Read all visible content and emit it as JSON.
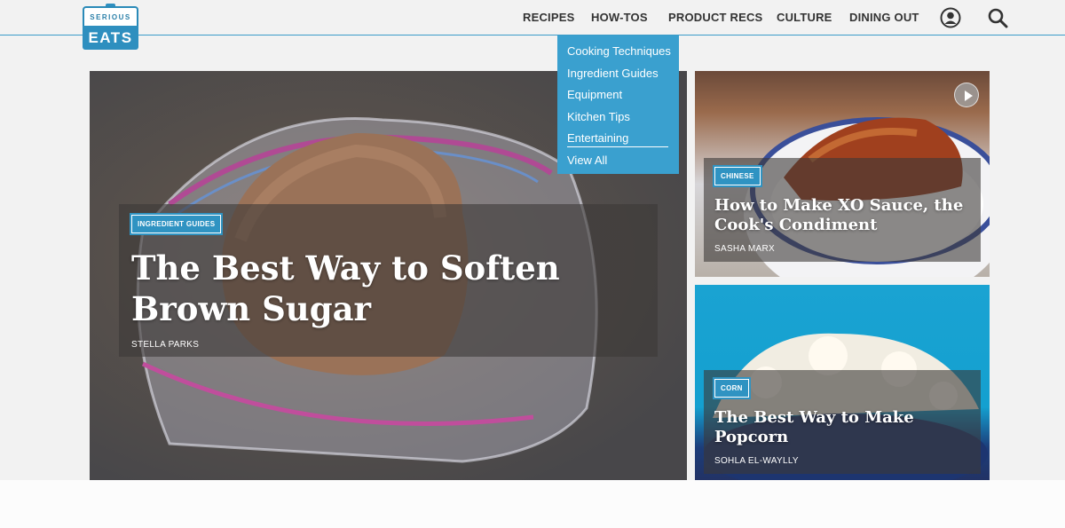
{
  "brand": {
    "top": "SERIOUS",
    "bottom": "EATS"
  },
  "nav": {
    "items": [
      {
        "label": "RECIPES"
      },
      {
        "label": "HOW-TOS"
      },
      {
        "label": "PRODUCT RECS"
      },
      {
        "label": "CULTURE"
      },
      {
        "label": "DINING OUT"
      }
    ]
  },
  "dropdown": {
    "items": [
      {
        "label": "Cooking Techniques"
      },
      {
        "label": "Ingredient Guides"
      },
      {
        "label": "Equipment"
      },
      {
        "label": "Kitchen Tips"
      },
      {
        "label": "Entertaining"
      },
      {
        "label": "View All"
      }
    ]
  },
  "hero": {
    "tag": "INGREDIENT GUIDES",
    "title_line1": "The Best Way to Soften",
    "title_line2": "Brown Sugar",
    "author": "STELLA PARKS"
  },
  "side1": {
    "tag": "CHINESE",
    "title_line1": "How to Make XO Sauce, the",
    "title_line2": "Cook's Condiment",
    "author": "SASHA MARX"
  },
  "side2": {
    "tag": "CORN",
    "title_line1": "The Best Way to Make",
    "title_line2": "Popcorn",
    "author": "SOHLA EL-WAYLLY"
  },
  "colors": {
    "accent": "#2f93c2",
    "dropdown": "#3aa0cf"
  }
}
